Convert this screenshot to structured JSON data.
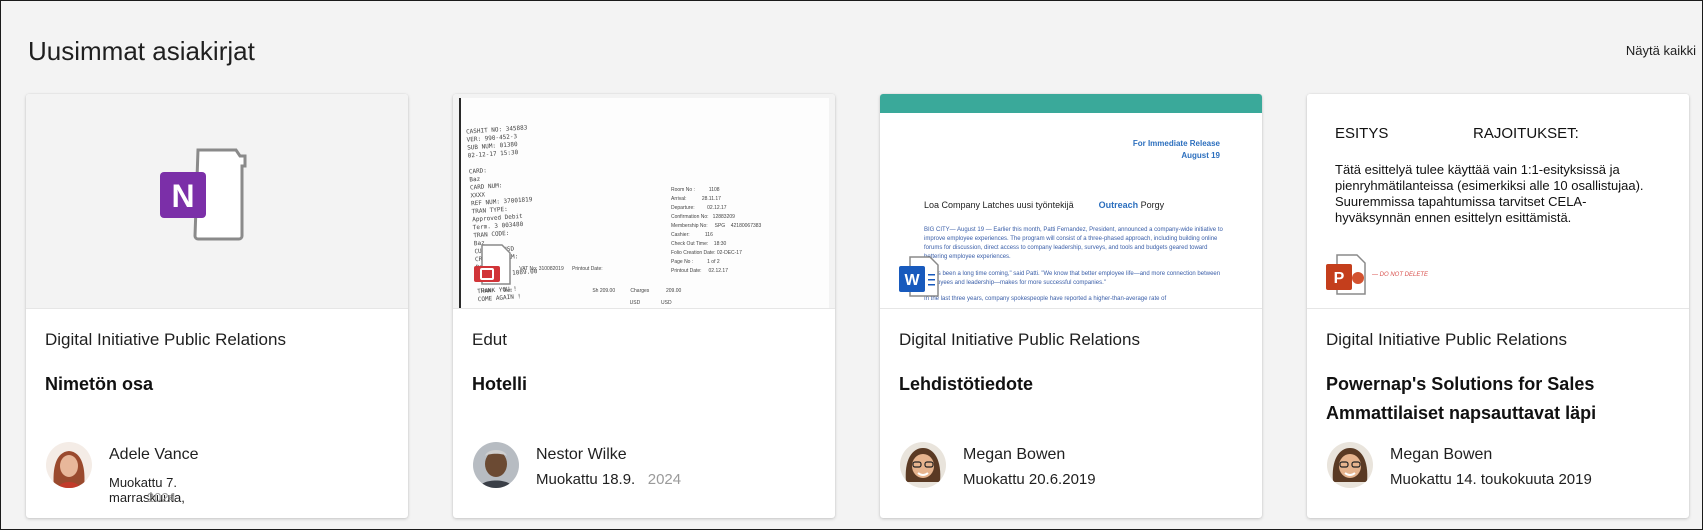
{
  "section": {
    "title": "Uusimmat asiakirjat",
    "show_all": "Näytä kaikki"
  },
  "cards": [
    {
      "site": "Digital Initiative Public Relations",
      "title": "Nimetön osa",
      "author": "Adele Vance",
      "modified": "Muokattu 7. marraskuuta,",
      "modified_faint": "2024",
      "app_icon": "onenote-icon",
      "app_letter": "N"
    },
    {
      "site": "Edut",
      "title": "Hotelli",
      "author": "Nestor Wilke",
      "modified": "Muokattu 18.9.",
      "modified_faint": "2024",
      "app_icon": "pdf-icon"
    },
    {
      "site": "Digital Initiative Public Relations",
      "title": "Lehdistötiedote",
      "author": "Megan Bowen",
      "modified": "Muokattu 20.6.2019",
      "app_icon": "word-icon",
      "app_letter": "W"
    },
    {
      "site": "Digital Initiative Public Relations",
      "title_line1": "Powernap's Solutions for Sales",
      "title_line2": "Ammattilaiset napsauttavat läpi",
      "author": "Megan Bowen",
      "modified": "Muokattu 14. toukokuuta 2019",
      "app_icon": "powerpoint-icon",
      "app_letter": "P"
    }
  ],
  "thumbs": {
    "receipt": {
      "strip": "CASHIT NO: 345883\nVER: 990-452-3\nSUB NUM: 01380\n02-12-17 15:30\n\nCARD:\nBaz\nCARD NUM:\nXXXX\nREF NUM: 37001819\nTRAN TYPE:\nApproved Debit\nTerm. 3 003480\nTRAN CODE:\nBaz\nCURREN: USD\nCREDIT TERM:\nBaz\nAMNT:     1089.00\n\nTHANK YOU !\nCOME AGAIN !",
      "cols": "Room No :          1108\nArrival:           28.11.17\nDeparture:         02.12.17\nConfirmation No:   12883209\nMembership No:     SPG    42180067383\nCashier:           116\nCheck Out Time:    18:30\nFolio Creation Date: 02-DEC-17\nPage No :          1 of 2\nPrintout Date:     02.12.17",
      "row1": "Tel Aviv Hotel      VAT No: 310082019      Printout Date:",
      "row2": "Date        Text                                                          Sh 209.00           Charges            209.00",
      "row3": "                                                                                                           USD               USD"
    },
    "press": {
      "release_line1": "For Immediate Release",
      "release_line2": "August 19",
      "headline": "Loa Company Latches uusi työntekijä",
      "headline_blue": "Outreach",
      "headline_end": "Porgy",
      "para1": "BIG CITY— August 19 — Earlier this month, Patti Fernandez, President, announced a company-wide initiative to improve employee experiences. The program will consist of a three-phased approach, including building online forums for discussion, direct access to company leadership, surveys, and tools and budgets geared toward bettering employee experiences.",
      "para2": "\"It has been a long time coming,\" said Patti. \"We know that better employee life—and more connection between employees and leadership—makes for more successful companies.\"",
      "para3": "In the last three years, company spokespeople have reported a higher-than-average rate of"
    },
    "ppt": {
      "h1": "ESITYS",
      "h2": "RAJOITUKSET:",
      "p": "Tätä esittelyä tulee käyttää vain 1:1-esityksissä ja pienryhmätilanteissa (esimerkiksi alle 10 osallistujaa). Suuremmissa tapahtumissa tarvitset CELA-hyväksynnän ennen esittelyn esittämistä.",
      "red": "— DO NOT DELETE"
    }
  }
}
